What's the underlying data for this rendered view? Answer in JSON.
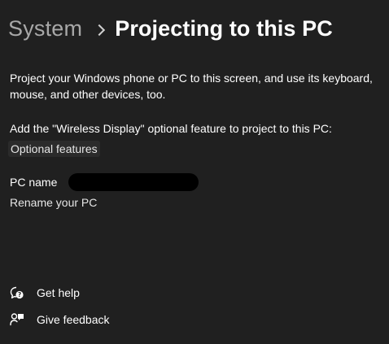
{
  "breadcrumb": {
    "parent": "System",
    "current": "Projecting to this PC"
  },
  "description": "Project your Windows phone or PC to this screen, and use its keyboard, mouse, and other devices, too.",
  "wireless_display": {
    "note": "Add the \"Wireless Display\" optional feature to project to this PC:",
    "link_label": "Optional features"
  },
  "pc_name": {
    "label": "PC name",
    "value_redacted": true,
    "rename_label": "Rename your PC"
  },
  "footer": {
    "help_label": "Get help",
    "help_icon": "help-icon",
    "feedback_label": "Give feedback",
    "feedback_icon": "feedback-icon"
  },
  "colors": {
    "background": "#202020",
    "text": "#ffffff",
    "muted": "#a8a8a8"
  }
}
